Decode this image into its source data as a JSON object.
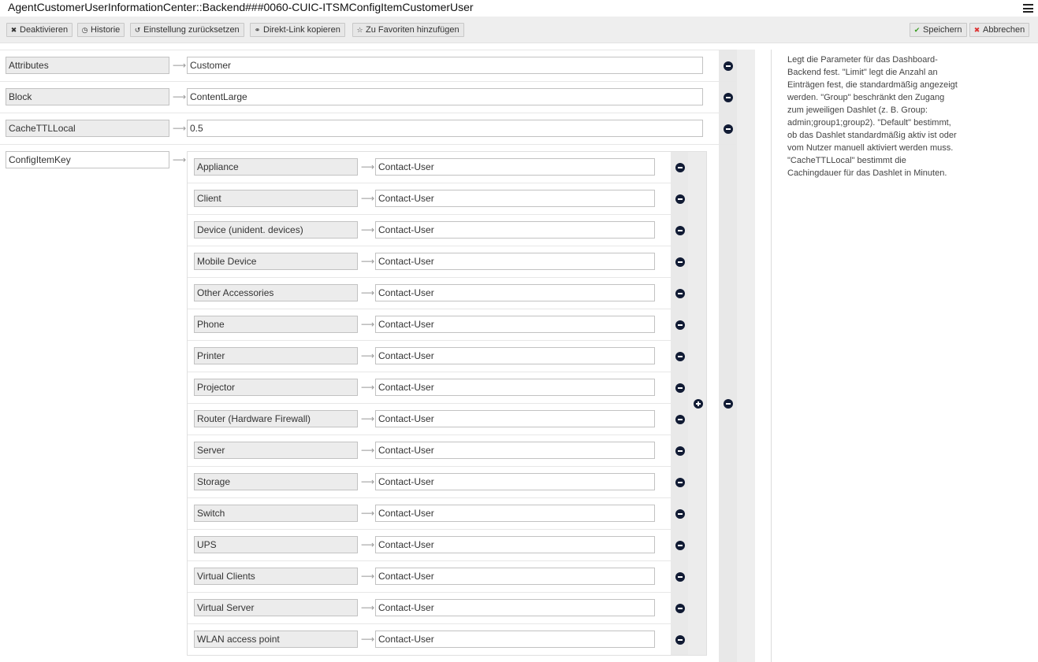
{
  "header": {
    "title": "AgentCustomerUserInformationCenter::Backend###0060-CUIC-ITSMConfigItemCustomerUser",
    "menu_icon": "hamburger-menu-icon"
  },
  "toolbar": {
    "deactivate_label": "Deaktivieren",
    "history_label": "Historie",
    "reset_label": "Einstellung zurücksetzen",
    "copy_link_label": "Direkt-Link kopieren",
    "favorite_label": "Zu Favoriten hinzufügen",
    "save_label": "Speichern",
    "cancel_label": "Abbrechen",
    "save_color": "#3a9d23",
    "cancel_color": "#dd3333"
  },
  "settings": [
    {
      "key": "Attributes",
      "value": "Customer"
    },
    {
      "key": "Block",
      "value": "ContentLarge"
    },
    {
      "key": "CacheTTLLocal",
      "value": "0.5"
    }
  ],
  "config_item": {
    "key": "ConfigItemKey",
    "entries": [
      {
        "key": "Appliance",
        "value": "Contact-User"
      },
      {
        "key": "Client",
        "value": "Contact-User"
      },
      {
        "key": "Device (unident. devices)",
        "value": "Contact-User"
      },
      {
        "key": "Mobile Device",
        "value": "Contact-User"
      },
      {
        "key": "Other Accessories",
        "value": "Contact-User"
      },
      {
        "key": "Phone",
        "value": "Contact-User"
      },
      {
        "key": "Printer",
        "value": "Contact-User"
      },
      {
        "key": "Projector",
        "value": "Contact-User"
      },
      {
        "key": "Router (Hardware Firewall)",
        "value": "Contact-User"
      },
      {
        "key": "Server",
        "value": "Contact-User"
      },
      {
        "key": "Storage",
        "value": "Contact-User"
      },
      {
        "key": "Switch",
        "value": "Contact-User"
      },
      {
        "key": "UPS",
        "value": "Contact-User"
      },
      {
        "key": "Virtual Clients",
        "value": "Contact-User"
      },
      {
        "key": "Virtual Server",
        "value": "Contact-User"
      },
      {
        "key": "WLAN access point",
        "value": "Contact-User"
      }
    ]
  },
  "help": {
    "lines": [
      "Legt die Parameter für das Dashboard-",
      "Backend fest. \"Limit\" legt die Anzahl an",
      "Einträgen fest, die standardmäßig angezeigt",
      "werden. \"Group\" beschränkt den Zugang",
      "zum jeweiligen Dashlet (z. B. Group:",
      "admin;group1;group2). \"Default\" bestimmt,",
      "ob das Dashlet standardmäßig aktiv ist oder",
      "vom Nutzer manuell aktiviert werden muss.",
      "\"CacheTTLLocal\" bestimmt die",
      "Cachingdauer für das Dashlet in Minuten."
    ]
  }
}
